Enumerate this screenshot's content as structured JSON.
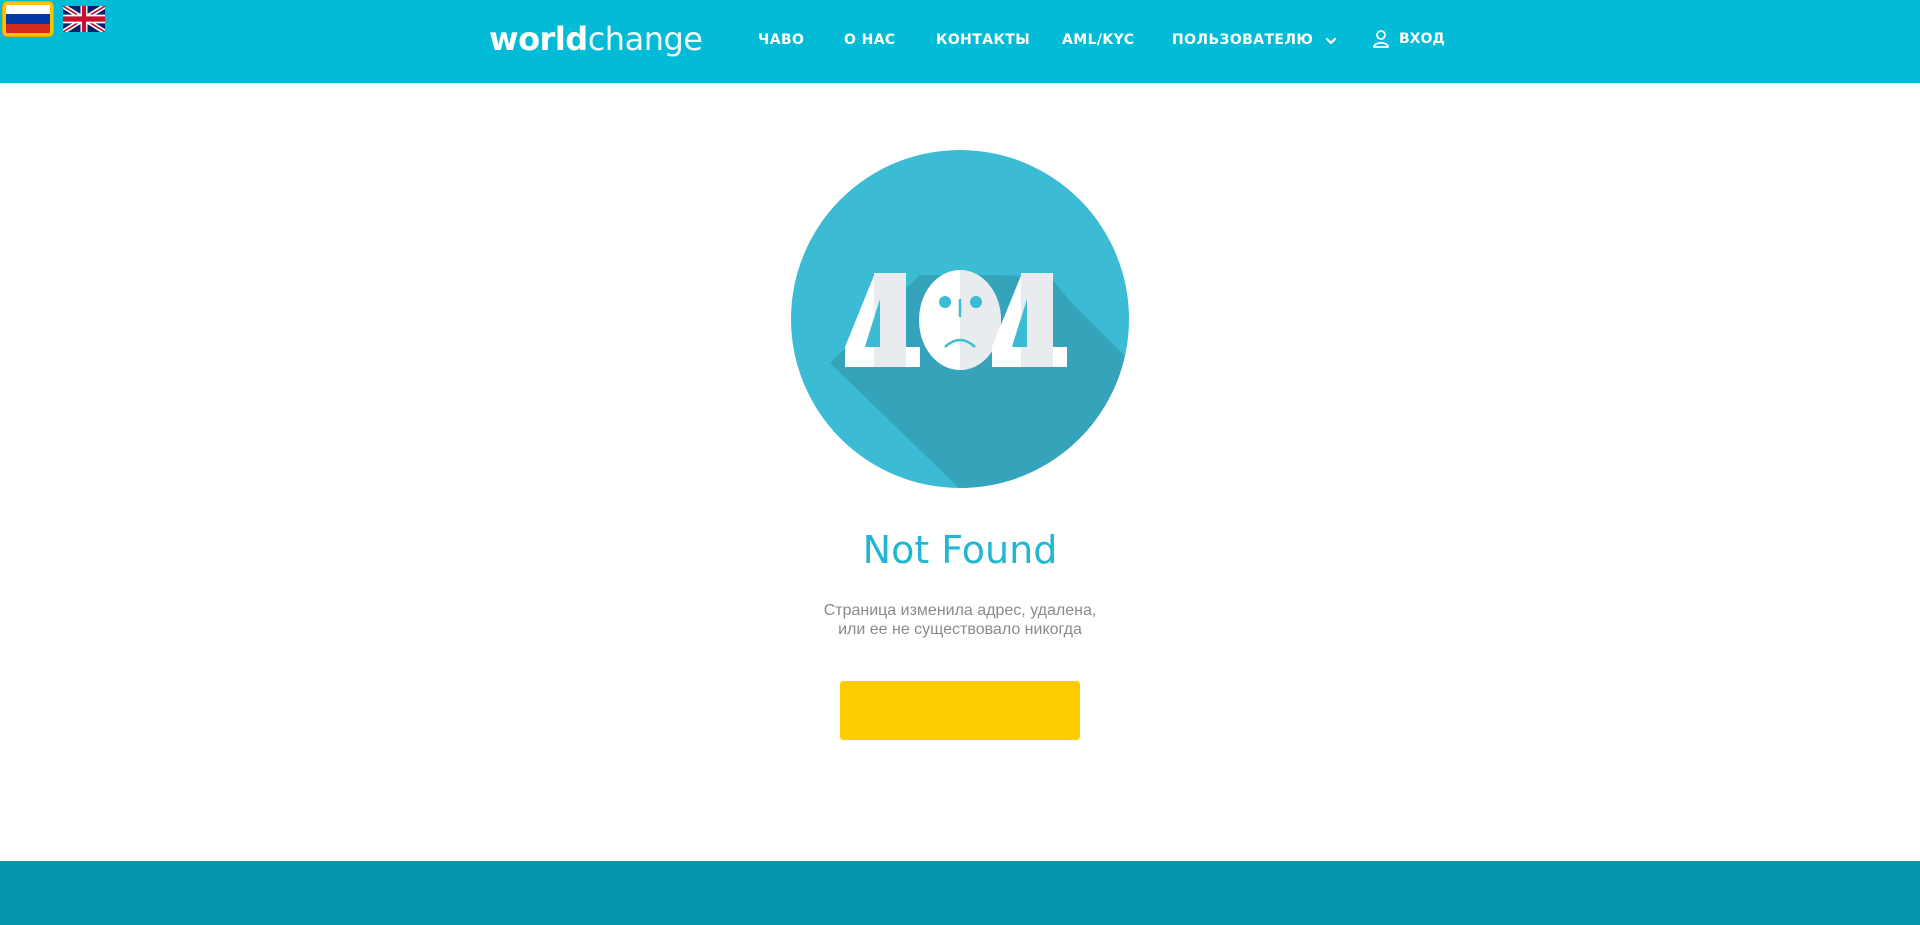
{
  "colors": {
    "header_bg": "#02bbd7",
    "footer_bg": "#0596ae",
    "accent_text": "#21b7d2",
    "button": "#fdcd00",
    "active_flag_border": "#f7c600"
  },
  "languages": [
    {
      "code": "ru",
      "icon": "russia-flag-icon",
      "active": true
    },
    {
      "code": "en",
      "icon": "uk-flag-icon",
      "active": false
    }
  ],
  "logo": {
    "bold": "world",
    "light": "change"
  },
  "nav": {
    "items": [
      "ЧАВО",
      "О НАС",
      "КОНТАКТЫ",
      "AML/KYC",
      "ПОЛЬЗОВАТЕЛЮ"
    ],
    "dropdown_icon": "chevron-down-icon",
    "login_label": "ВХОД",
    "login_icon": "user-icon"
  },
  "error": {
    "code": "404",
    "title": "Not Found",
    "desc_line1": "Страница изменила адрес, удалена,",
    "desc_line2": "или ее не существовало никогда",
    "button_label": ""
  }
}
